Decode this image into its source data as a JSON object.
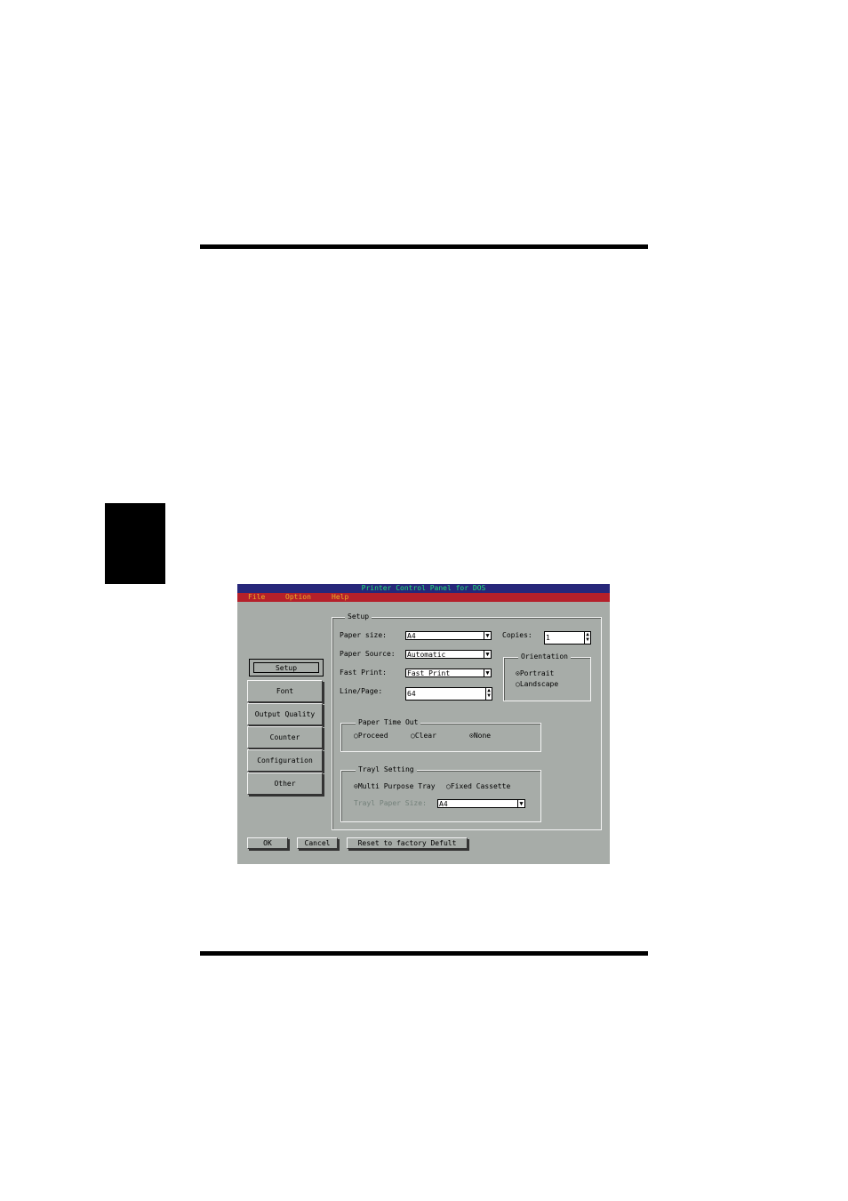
{
  "window": {
    "title": "Printer Control Panel for DOS"
  },
  "menu": {
    "items": [
      "File",
      "Option",
      "Help"
    ]
  },
  "tabs": [
    "Setup",
    "Font",
    "Output Quality",
    "Counter",
    "Configuration",
    "Other"
  ],
  "setup": {
    "group_title": "Setup",
    "paper_size": {
      "label": "Paper size:",
      "value": "A4"
    },
    "paper_source": {
      "label": "Paper Source:",
      "value": "Automatic"
    },
    "fast_print": {
      "label": "Fast Print:",
      "value": "Fast Print"
    },
    "line_page": {
      "label": "Line/Page:",
      "value": "64"
    },
    "copies": {
      "label": "Copies:",
      "value": "1"
    }
  },
  "orientation": {
    "title": "Orientation",
    "options": [
      "Portrait",
      "Landscape"
    ],
    "selected": "Portrait"
  },
  "paper_timeout": {
    "title": "Paper Time Out",
    "options": [
      "Proceed",
      "Clear",
      "None"
    ],
    "selected": "None"
  },
  "tray_setting": {
    "title": "Trayl Setting",
    "options": [
      "Multi Purpose Tray",
      "Fixed Cassette"
    ],
    "selected": "Multi Purpose Tray",
    "paper_size_label": "Trayl Paper Size:",
    "paper_size_value": "A4"
  },
  "buttons": {
    "ok": "OK",
    "cancel": "Cancel",
    "reset": "Reset to factory Defult"
  }
}
